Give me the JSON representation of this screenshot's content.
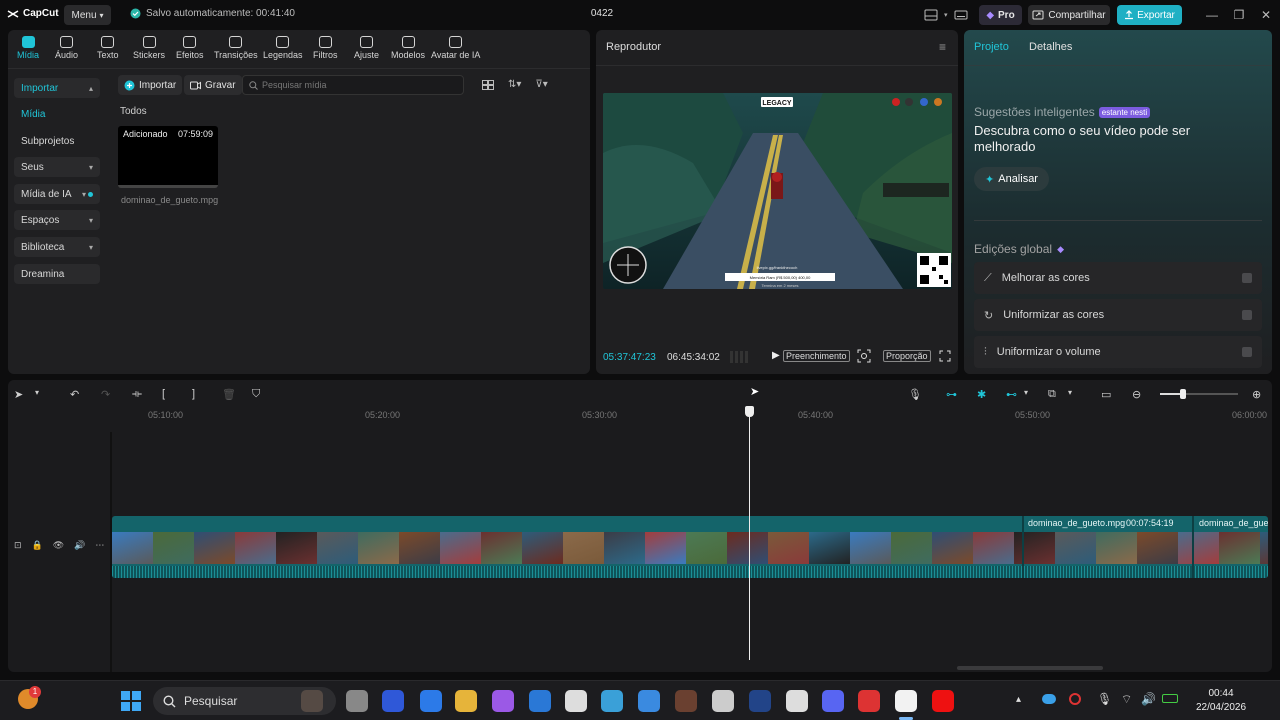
{
  "app": {
    "logo_text": "CapCut",
    "menu_label": "Menu",
    "autosave": "Salvo automaticamente: 00:41:40",
    "project_name": "0422",
    "pro_label": "Pro",
    "share_label": "Compartilhar",
    "export_label": "Exportar",
    "accent": "#20c5d8"
  },
  "media_toolbar": [
    {
      "label": "Mídia",
      "icon": "media-icon",
      "active": true
    },
    {
      "label": "Áudio",
      "icon": "audio-icon"
    },
    {
      "label": "Texto",
      "icon": "text-icon"
    },
    {
      "label": "Stickers",
      "icon": "sticker-icon"
    },
    {
      "label": "Efeitos",
      "icon": "effects-icon"
    },
    {
      "label": "Transições",
      "icon": "transitions-icon"
    },
    {
      "label": "Legendas",
      "icon": "captions-icon"
    },
    {
      "label": "Filtros",
      "icon": "filters-icon"
    },
    {
      "label": "Ajuste",
      "icon": "adjust-icon"
    },
    {
      "label": "Modelos",
      "icon": "templates-icon"
    },
    {
      "label": "Avatar de IA",
      "icon": "ai-avatar-icon"
    }
  ],
  "sidebar": {
    "import": "Importar",
    "media": "Mídia",
    "subprojects": "Subprojetos",
    "yours": "Seus",
    "ai_media": "Mídia de IA",
    "spaces": "Espaços",
    "library": "Biblioteca",
    "dreamina": "Dreamina"
  },
  "media_area": {
    "import_btn": "Importar",
    "record_btn": "Gravar",
    "search_placeholder": "Pesquisar mídia",
    "filter_label": "Todos",
    "item": {
      "status": "Adicionado",
      "duration": "07:59:09",
      "filename": "dominao_de_gueto.mpg"
    }
  },
  "player": {
    "title": "Reprodutor",
    "current_time": "05:37:47:23",
    "total_time": "06:45:34:02",
    "fill_label": "Preenchimento",
    "ratio_label": "Proporção",
    "video": {
      "legacy": "LEGACY",
      "url_text": "livepix.gg/frankthecoch",
      "bar_text": "Memória Ram (R$ 500,00) 400,00",
      "bar_sub": "Termina em 2 meses"
    }
  },
  "right_panel": {
    "tab_project": "Projeto",
    "tab_details": "Detalhes",
    "smart_title": "Sugestões inteligentes",
    "smart_badge": "estante nesti",
    "smart_desc": "Descubra como o seu vídeo pode ser melhorado",
    "analyze_btn": "Analisar",
    "global_title": "Edições global",
    "options": [
      "Melhorar as cores",
      "Uniformizar as cores",
      "Uniformizar o volume"
    ]
  },
  "timeline": {
    "ruler": [
      "05:10:00",
      "05:20:00",
      "05:30:00",
      "05:40:00",
      "05:50:00",
      "06:00:00"
    ],
    "clip1_name": "dominao_de_gueto.mpg",
    "clip1_duration": "00:07:54:19",
    "clip2_name": "dominao_de_gueto.mpg"
  },
  "taskbar": {
    "search_label": "Pesquisar",
    "time": "00:44",
    "date": "22/04/2026",
    "badge_count": "1"
  }
}
